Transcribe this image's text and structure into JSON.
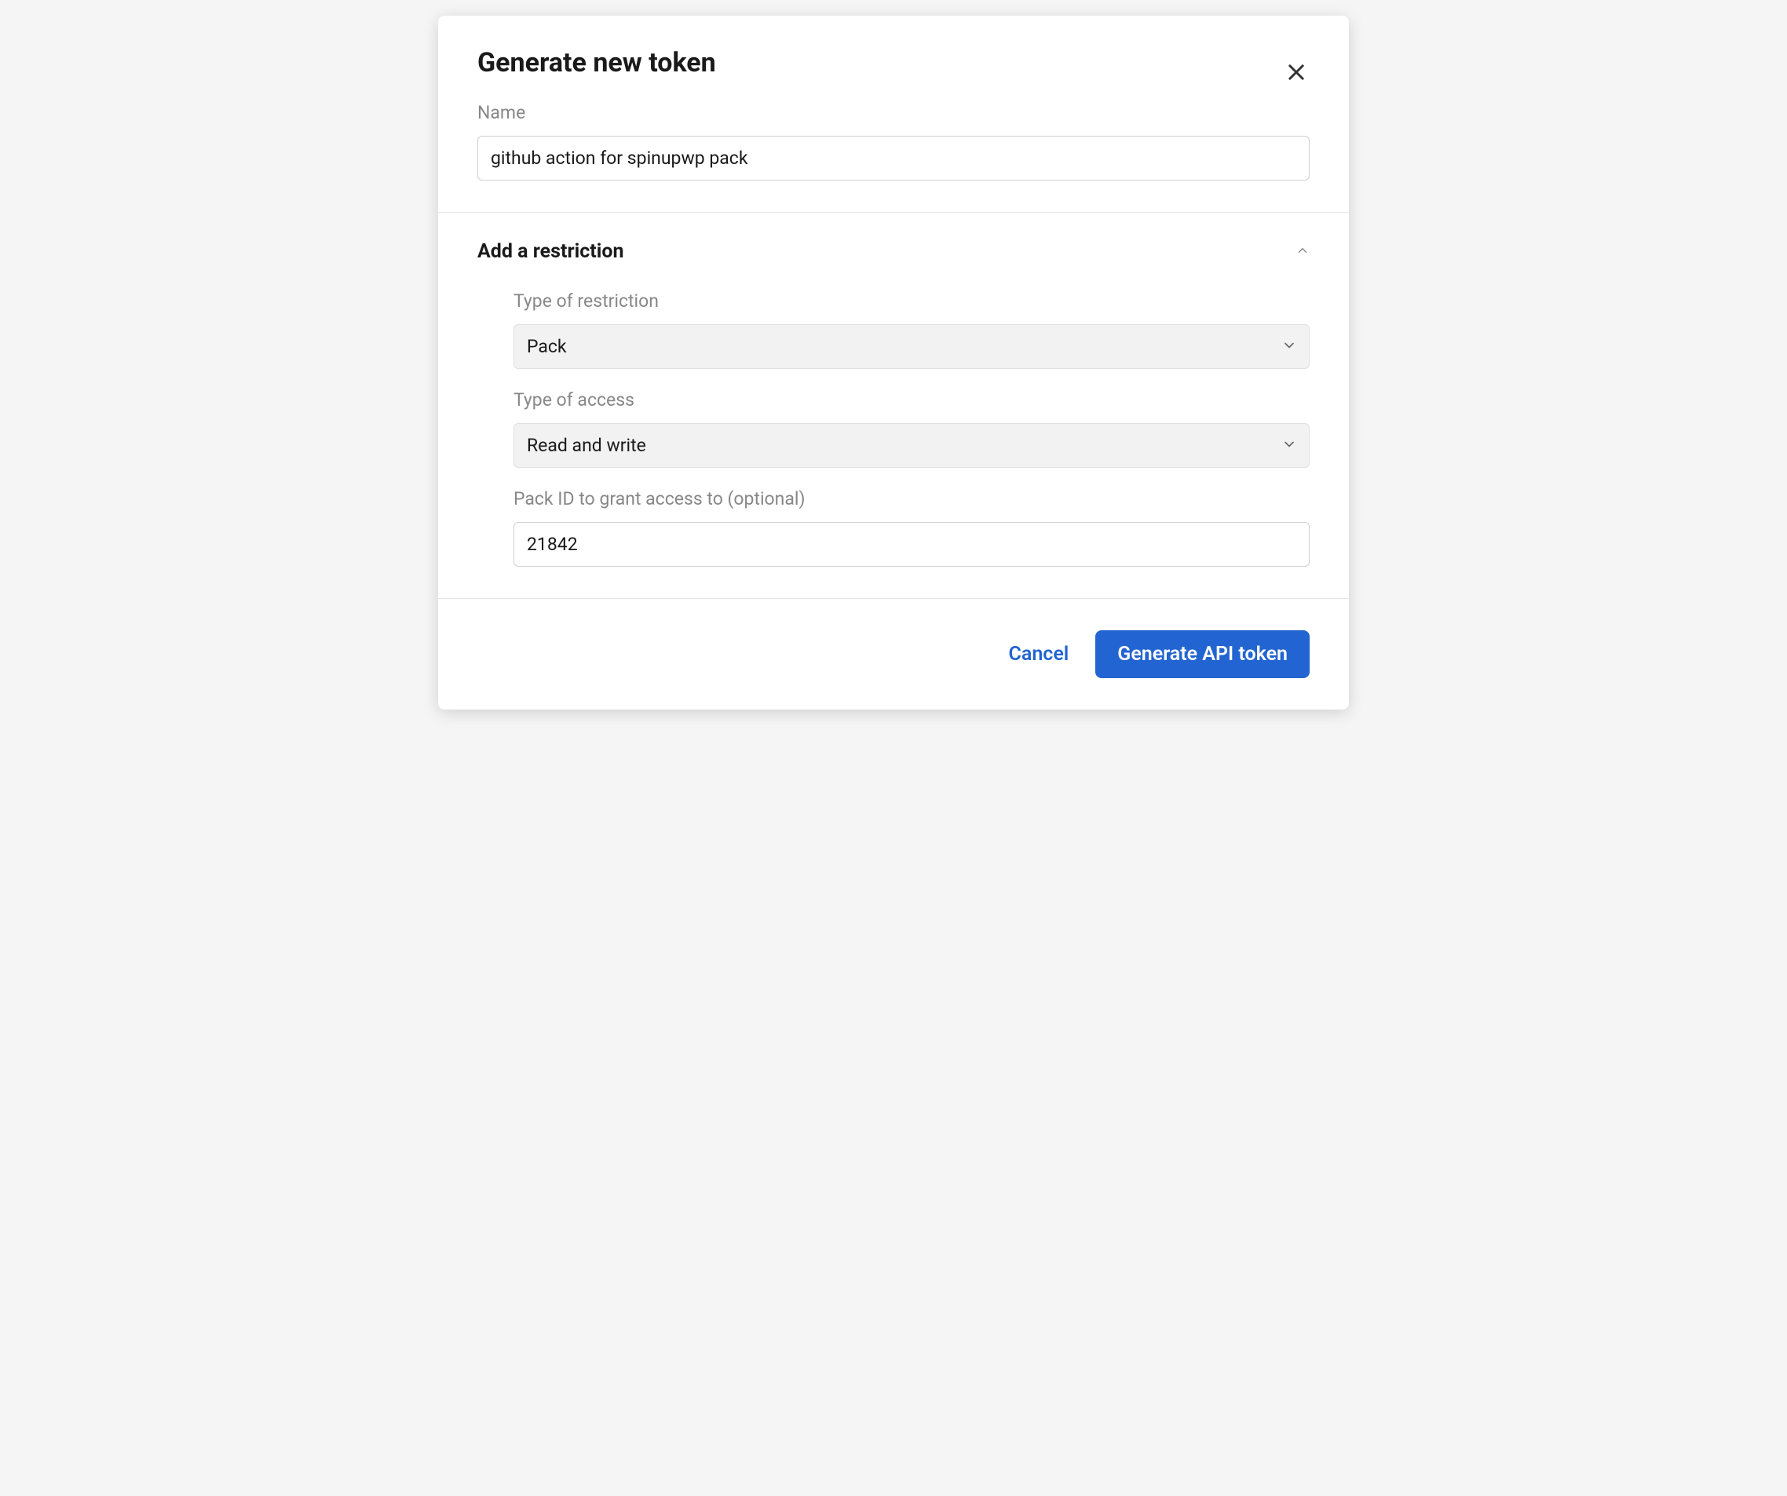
{
  "dialog": {
    "title": "Generate new token",
    "name_label": "Name",
    "name_value": "github action for spinupwp pack",
    "restriction": {
      "title": "Add a restriction",
      "type_label": "Type of restriction",
      "type_value": "Pack",
      "access_label": "Type of access",
      "access_value": "Read and write",
      "pack_id_label": "Pack ID to grant access to (optional)",
      "pack_id_value": "21842"
    },
    "cancel_label": "Cancel",
    "submit_label": "Generate API token"
  }
}
